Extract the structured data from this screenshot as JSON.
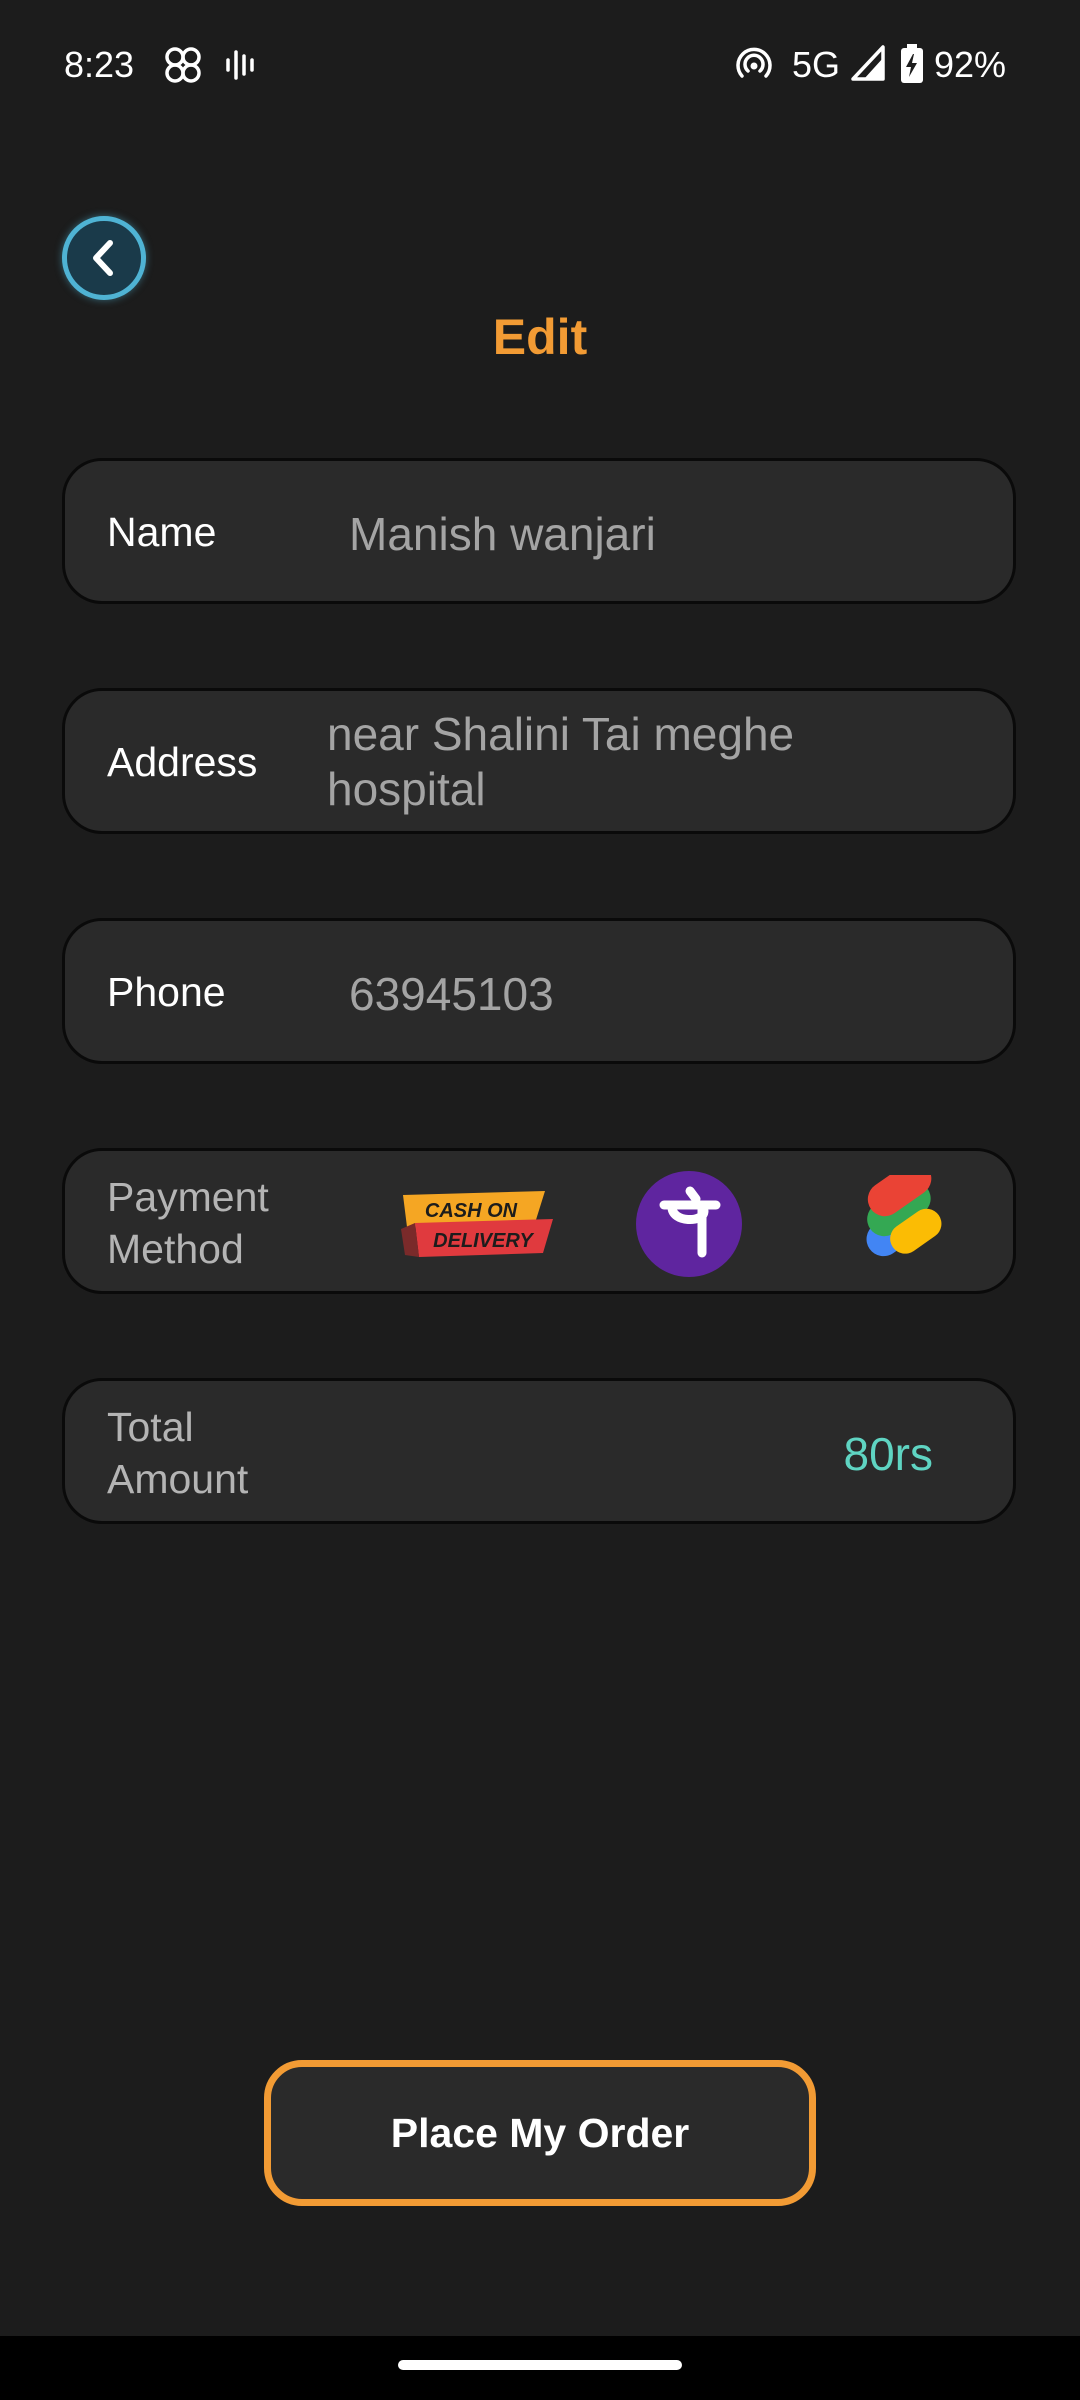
{
  "status_bar": {
    "time": "8:23",
    "network": "5G",
    "battery": "92%",
    "icons": [
      "pinwheel-icon",
      "voice-waveform-icon",
      "hotspot-icon",
      "signal-icon",
      "battery-charging-icon"
    ]
  },
  "header": {
    "back_icon": "chevron-left-icon",
    "title": "Edit"
  },
  "form": {
    "name": {
      "label": "Name",
      "value": "Manish wanjari"
    },
    "address": {
      "label": "Address",
      "value_line1": "near Shalini Tai meghe",
      "value_line2": "hospital"
    },
    "phone": {
      "label": "Phone",
      "value": "63945103"
    },
    "payment": {
      "label_line1": "Payment",
      "label_line2": "Method",
      "options": [
        "cash-on-delivery-logo",
        "phonepe-logo",
        "google-pay-logo"
      ],
      "cod_text_1": "CASH ON",
      "cod_text_2": "DELIVERY"
    },
    "total": {
      "label_line1": "Total",
      "label_line2": "Amount",
      "value": "80rs"
    }
  },
  "actions": {
    "place_order_label": "Place My Order"
  },
  "colors": {
    "accent": "#f29b34",
    "amount": "#5fd4c2",
    "back_ring": "#4fb3d4",
    "background": "#1c1c1c",
    "card": "#2a2a2a"
  }
}
